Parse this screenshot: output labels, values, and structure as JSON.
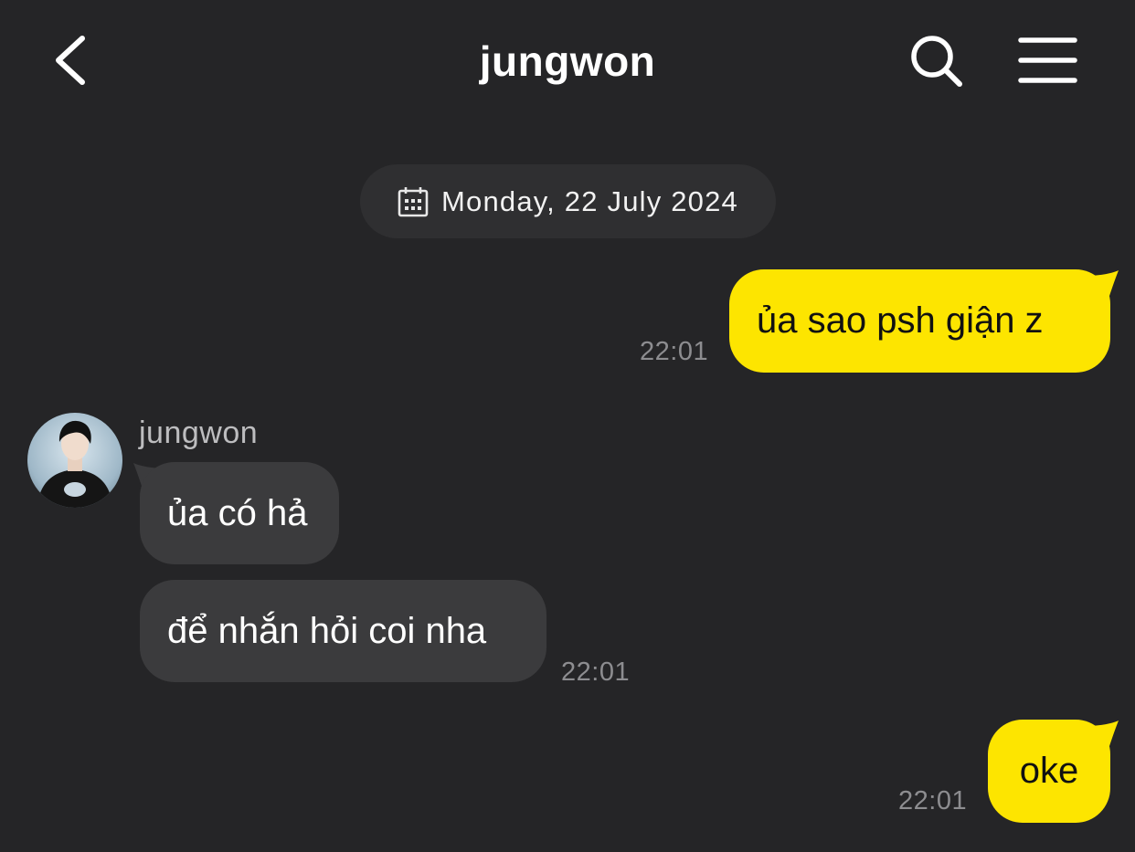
{
  "header": {
    "title": "jungwon",
    "back_icon": "chevron-left-icon",
    "search_icon": "search-icon",
    "menu_icon": "hamburger-menu-icon"
  },
  "date_separator": {
    "icon": "calendar-icon",
    "label": "Monday, 22 July 2024"
  },
  "contact": {
    "name": "jungwon",
    "avatar_icon": "avatar"
  },
  "messages": [
    {
      "direction": "outgoing",
      "text": "ủa sao psh giận z",
      "time": "22:01"
    },
    {
      "direction": "incoming",
      "text": "ủa có hả",
      "time": ""
    },
    {
      "direction": "incoming",
      "text": "để nhắn hỏi coi nha",
      "time": "22:01"
    },
    {
      "direction": "outgoing",
      "text": "oke",
      "time": "22:01"
    }
  ],
  "colors": {
    "background": "#252527",
    "outgoing_bubble": "#fde500",
    "incoming_bubble": "#3b3b3d",
    "date_pill": "#2f2f31",
    "timestamp": "#8d8d90"
  }
}
